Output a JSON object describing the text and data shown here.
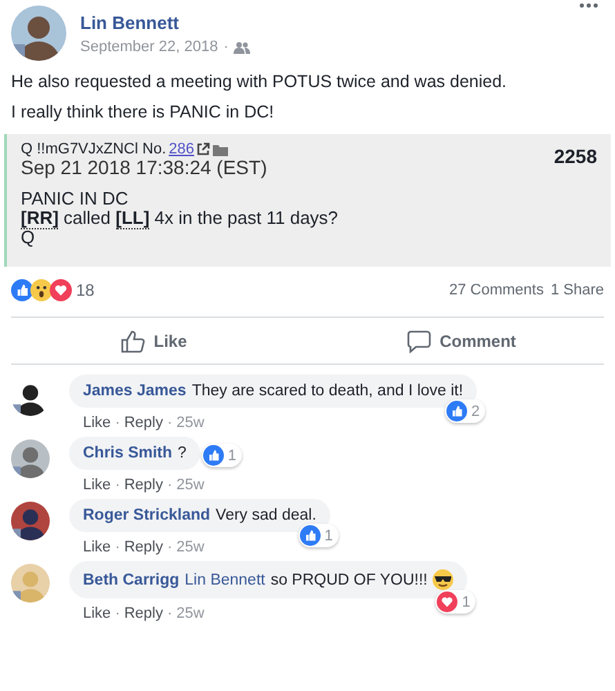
{
  "post": {
    "author": "Lin Bennett",
    "date": "September 22, 2018",
    "date_separator": "·",
    "audience": {
      "kind": "friends"
    },
    "paragraphs": [
      "He also requested a meeting with POTUS twice and was denied.",
      "I really think there is PANIC in DC!"
    ],
    "quote": {
      "header": "Q !!mG7VJxZNCl No.",
      "post_link": "286",
      "number": "2258",
      "timestamp": "Sep 21 2018 17:38:24 (EST)",
      "lines": [
        "PANIC IN DC",
        "**[RR]** called **[LL]** 4x in the past 11 days?",
        "Q"
      ]
    },
    "reactions": {
      "icons": [
        {
          "kind": "like"
        },
        {
          "kind": "wow"
        },
        {
          "kind": "love"
        }
      ],
      "count": "18"
    },
    "comments_count": "27 Comments",
    "shares_count": "1 Share",
    "actions": [
      {
        "kind": "like",
        "label": "Like"
      },
      {
        "kind": "comment",
        "label": "Comment"
      }
    ]
  },
  "comments": [
    {
      "author": "James James",
      "text": "They are scared to death, and I love it!",
      "reaction": {
        "kind": "like",
        "count": "2"
      },
      "meta": [
        "Like",
        "·",
        "Reply",
        "·",
        "25w"
      ]
    },
    {
      "author": "Chris Smith",
      "text": "?",
      "reaction": {
        "kind": "like",
        "count": "1"
      },
      "meta": [
        "Like",
        "·",
        "Reply",
        "·",
        "25w"
      ]
    },
    {
      "author": "Roger Strickland",
      "text": "Very sad deal.",
      "reaction": {
        "kind": "like",
        "count": "1"
      },
      "meta": [
        "Like",
        "·",
        "Reply",
        "·",
        "25w"
      ]
    },
    {
      "author": "Beth Carrigg",
      "mention": "Lin Bennett",
      "text": "so PRQUD OF YOU!!!",
      "emoji": {
        "kind": "sunglasses"
      },
      "reaction": {
        "kind": "love",
        "count": "1"
      },
      "meta": [
        "Like",
        "·",
        "Reply",
        "·",
        "25w"
      ]
    }
  ]
}
